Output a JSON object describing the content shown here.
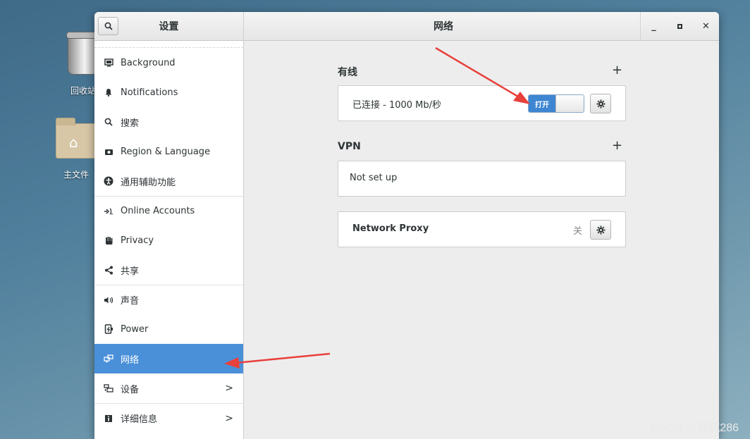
{
  "desktop": {
    "trash_label": "回收站",
    "home_label": "主文件"
  },
  "window": {
    "sidebar_title": "设置",
    "main_title": "网络"
  },
  "sidebar": {
    "items": [
      {
        "label": "Background",
        "icon": "background-icon"
      },
      {
        "label": "Notifications",
        "icon": "bell-icon"
      },
      {
        "label": "搜索",
        "icon": "search-icon"
      },
      {
        "label": "Region & Language",
        "icon": "camera-icon"
      },
      {
        "label": "通用辅助功能",
        "icon": "accessibility-icon"
      },
      {
        "label": "Online Accounts",
        "icon": "online-accounts-icon"
      },
      {
        "label": "Privacy",
        "icon": "hand-icon"
      },
      {
        "label": "共享",
        "icon": "share-icon"
      },
      {
        "label": "声音",
        "icon": "speaker-icon"
      },
      {
        "label": "Power",
        "icon": "power-icon"
      },
      {
        "label": "网络",
        "icon": "network-icon"
      },
      {
        "label": "设备",
        "icon": "devices-icon"
      },
      {
        "label": "详细信息",
        "icon": "info-icon"
      }
    ]
  },
  "network": {
    "wired_heading": "有线",
    "wired_status": "已连接 - 1000 Mb/秒",
    "wired_toggle": "打开",
    "vpn_heading": "VPN",
    "vpn_status": "Not set up",
    "proxy_label": "Network Proxy",
    "proxy_state": "关"
  },
  "watermark": "CSDN @孤城286",
  "colors": {
    "accent": "#4a90d9",
    "annotation_arrow": "#e8403a"
  }
}
